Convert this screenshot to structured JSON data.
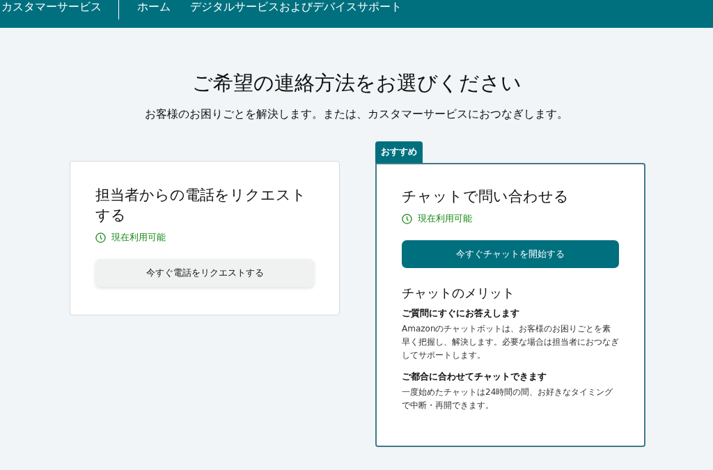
{
  "header": {
    "title": "カスタマーサービス",
    "nav": [
      {
        "label": "ホーム"
      },
      {
        "label": "デジタルサービスおよびデバイスサポート"
      }
    ]
  },
  "heading": "ご希望の連絡方法をお選びください",
  "subheading": "お客様のお困りごとを解決します。または、カスタマーサービスにおつなぎします。",
  "cards": [
    {
      "title": "担当者からの電話をリクエストする",
      "availability": "現在利用可能",
      "button": {
        "label": "今すぐ電話をリクエストする",
        "kind": "secondary"
      }
    },
    {
      "badge": "おすすめ",
      "title": "チャットで問い合わせる",
      "availability": "現在利用可能",
      "button": {
        "label": "今すぐチャットを開始する",
        "kind": "primary"
      },
      "benefits": {
        "title": "チャットのメリット",
        "items": [
          {
            "title": "ご質問にすぐにお答えします",
            "text": "Amazonのチャットボットは、お客様のお困りごとを素早く把握し、解決します。必要な場合は担当者におつなぎしてサポートします。"
          },
          {
            "title": "ご都合に合わせてチャットできます",
            "text": "一度始めたチャットは24時間の間、お好きなタイミングで中断・再開できます。"
          }
        ]
      }
    }
  ]
}
